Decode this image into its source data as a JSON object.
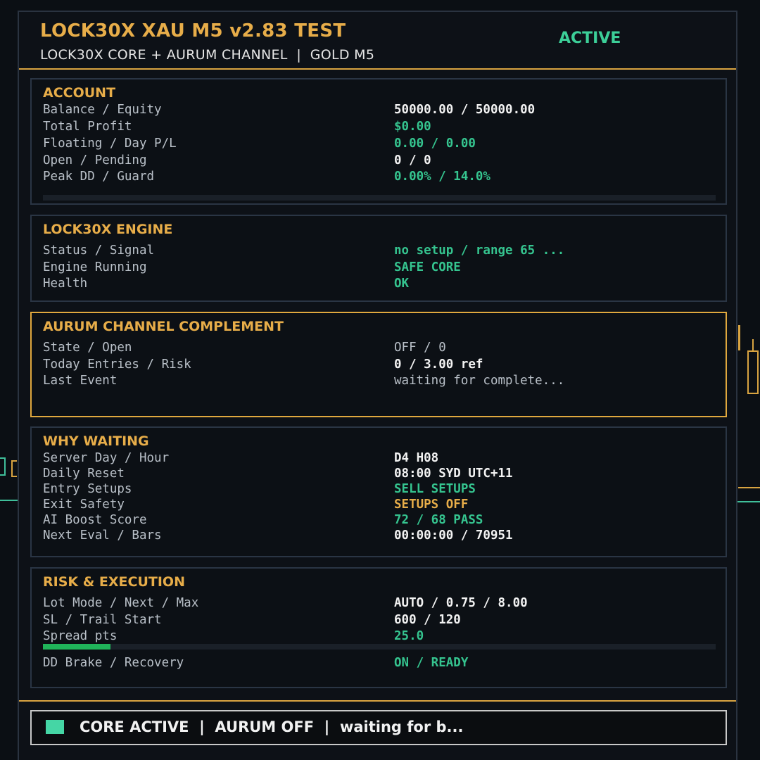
{
  "header": {
    "title": "LOCK30X XAU M5 v2.83 TEST",
    "subtitle": "LOCK30X CORE + AURUM CHANNEL  |  GOLD M5",
    "state": "ACTIVE"
  },
  "account": {
    "title": "ACCOUNT",
    "rows": [
      {
        "label": "Balance / Equity",
        "value": "50000.00 / 50000.00"
      },
      {
        "label": "Total Profit",
        "value": "$0.00"
      },
      {
        "label": "Floating / Day P/L",
        "value": "0.00 / 0.00"
      },
      {
        "label": "Open / Pending",
        "value": "0 / 0"
      },
      {
        "label": "Peak DD / Guard",
        "value": "0.00% / 14.0%"
      }
    ],
    "dd_progress": 0
  },
  "engine": {
    "title": "LOCK30X ENGINE",
    "rows": [
      {
        "label": "Status / Signal",
        "value": "no setup / range 65 ..."
      },
      {
        "label": "Engine Running",
        "value": "SAFE CORE"
      },
      {
        "label": "Health",
        "value": "OK"
      }
    ]
  },
  "aurum": {
    "title": "AURUM CHANNEL COMPLEMENT",
    "rows": [
      {
        "label": "State / Open",
        "value": "OFF / 0"
      },
      {
        "label": "Today Entries / Risk",
        "value": "0 / 3.00 ref"
      },
      {
        "label": "Last Event",
        "value": "waiting for complete..."
      }
    ]
  },
  "waiting": {
    "title": "WHY WAITING",
    "rows": [
      {
        "label": "Server Day / Hour",
        "value": "D4 H08"
      },
      {
        "label": "Daily Reset",
        "value": "08:00 SYD UTC+11"
      },
      {
        "label": "Entry Setups",
        "value": "SELL SETUPS"
      },
      {
        "label": "Exit Safety",
        "value": "SETUPS OFF"
      },
      {
        "label": "AI Boost Score",
        "value": "72 / 68 PASS"
      },
      {
        "label": "Next Eval / Bars",
        "value": "00:00:00 / 70951"
      }
    ]
  },
  "risk": {
    "title": "RISK & EXECUTION",
    "rows": [
      {
        "label": "Lot Mode / Next / Max",
        "value": "AUTO / 0.75 / 8.00"
      },
      {
        "label": "SL / Trail Start",
        "value": "600 / 120"
      },
      {
        "label": "Spread pts",
        "value": "25.0"
      },
      {
        "label": "DD Brake / Recovery",
        "value": "ON / READY"
      }
    ],
    "spread_progress": 0.1
  },
  "footer": {
    "status": "CORE ACTIVE  |  AURUM OFF  |  waiting for b..."
  },
  "colors": {
    "accent": "#e7ad49",
    "positive": "#35c48f",
    "background": "#0d1117",
    "status_indicator": "#45d6a5"
  }
}
